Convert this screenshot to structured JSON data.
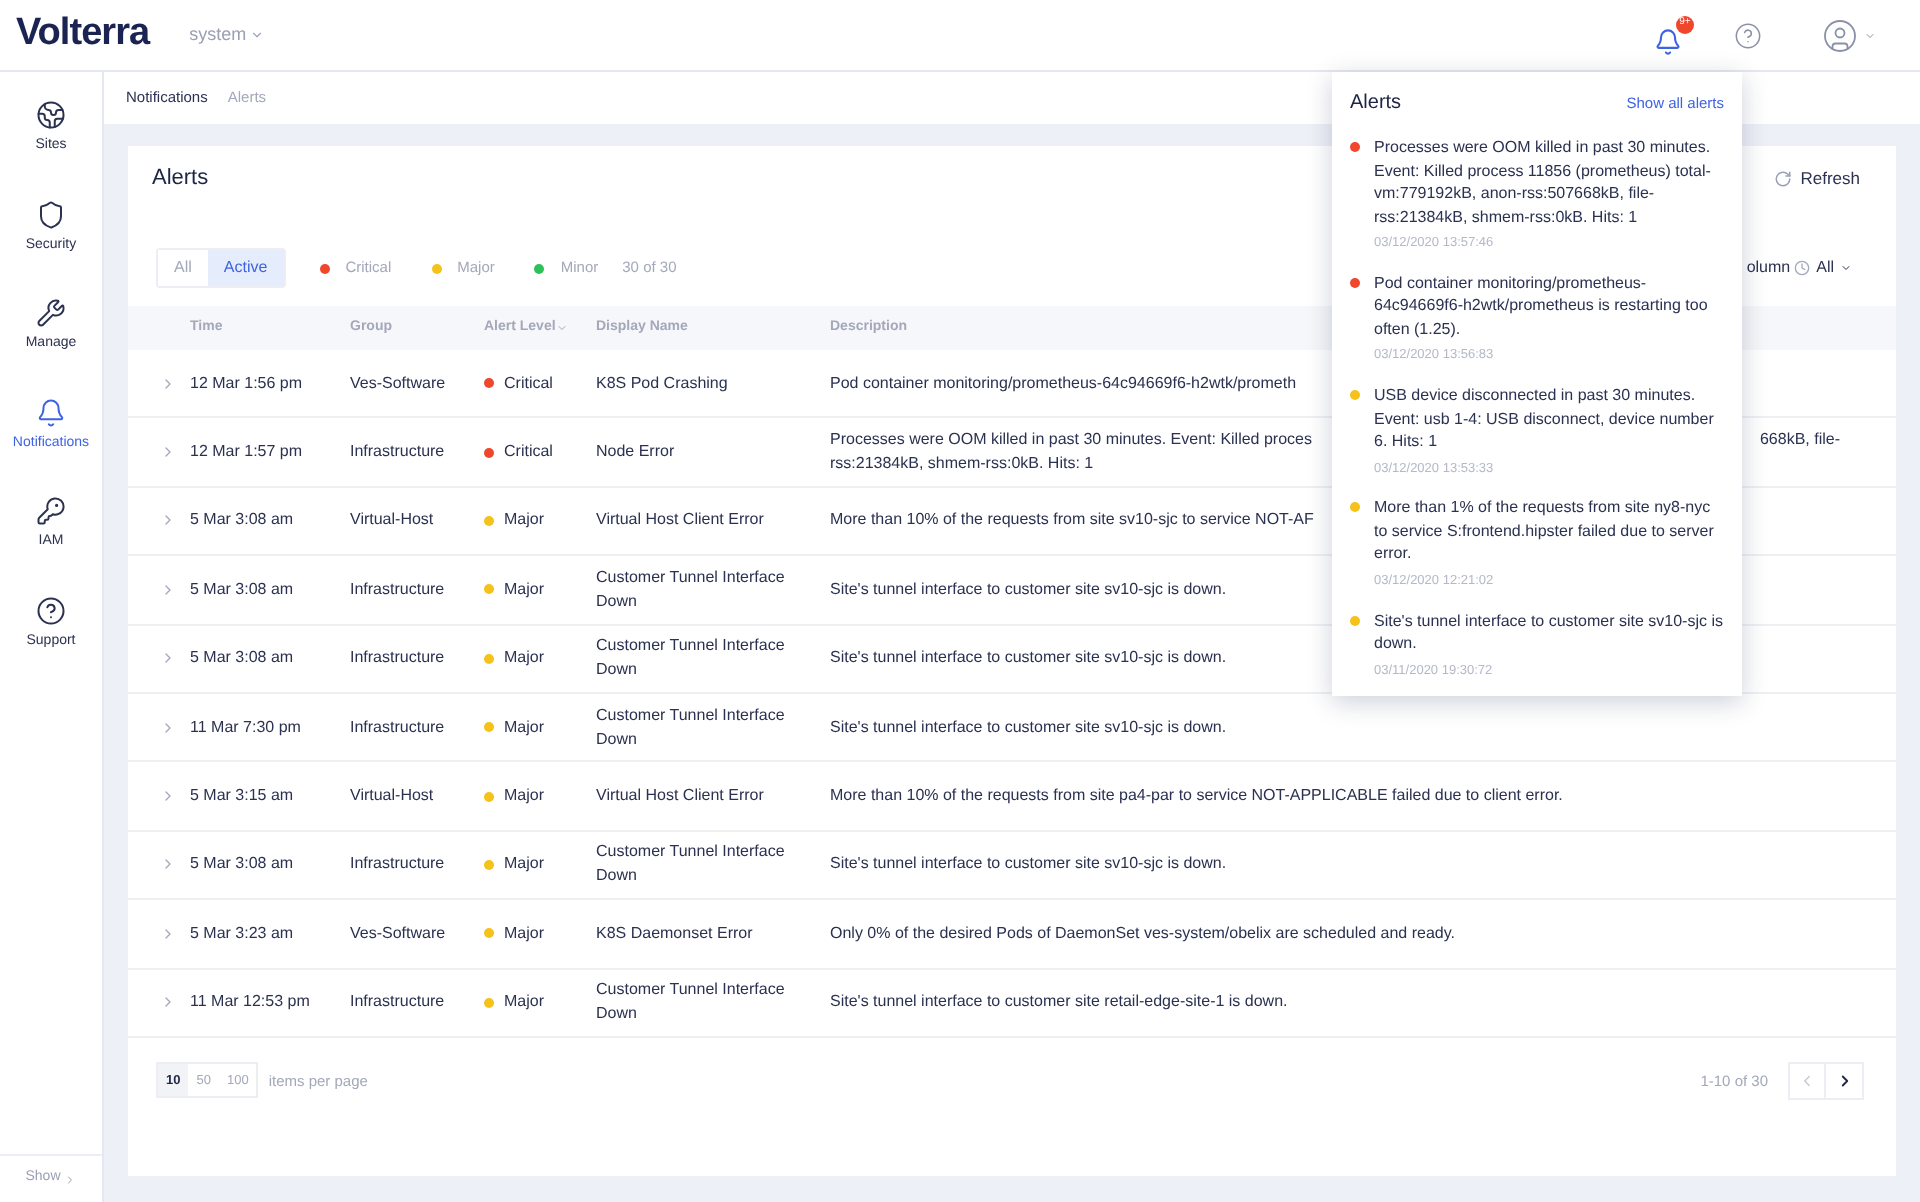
{
  "topbar": {
    "logo": "Volterra",
    "namespace": "system",
    "badge": "9+"
  },
  "sidebar": {
    "items": [
      {
        "label": "Sites",
        "kind": "sites",
        "selected": false
      },
      {
        "label": "Security",
        "kind": "security",
        "selected": false
      },
      {
        "label": "Manage",
        "kind": "manage",
        "selected": false
      },
      {
        "label": "Notifications",
        "kind": "notifications",
        "selected": true
      },
      {
        "label": "IAM",
        "kind": "iam",
        "selected": false
      },
      {
        "label": "Support",
        "kind": "support",
        "selected": false
      }
    ],
    "footer": "Show"
  },
  "breadcrumb": [
    "Notifications",
    "Alerts"
  ],
  "card": {
    "title": "Alerts",
    "refresh": "Refresh",
    "column_button": "olumn",
    "time_filter": "All"
  },
  "filter_tabs": [
    {
      "label": "All",
      "selected": false
    },
    {
      "label": "Active",
      "selected": true
    }
  ],
  "legend": [
    {
      "label": "Critical",
      "color": "#f0462c"
    },
    {
      "label": "Major",
      "color": "#f5c21b"
    },
    {
      "label": "Minor",
      "color": "#2ec15b"
    }
  ],
  "count": "30 of 30",
  "table": {
    "columns": [
      "Time",
      "Group",
      "Alert Level",
      "Display Name",
      "Description"
    ],
    "rows": [
      {
        "time": "12 Mar 1:56 pm",
        "group": "Ves-Software",
        "level": "Critical",
        "color": "#f0462c",
        "display_name": "K8S Pod Crashing",
        "description": "Pod container monitoring/prometheus-64c94669f6-h2wtk/prometh"
      },
      {
        "time": "12 Mar 1:57 pm",
        "group": "Infrastructure",
        "level": "Critical",
        "color": "#f0462c",
        "display_name": "Node Error",
        "description": "Processes were OOM killed in past 30 minutes. Event: Killed proces",
        "description_end": "668kB, file-",
        "description_line_2": "rss:21384kB, shmem-rss:0kB. Hits: 1"
      },
      {
        "time": "5 Mar 3:08 am",
        "group": "Virtual-Host",
        "level": "Major",
        "color": "#f5c21b",
        "display_name": "Virtual Host Client Error",
        "description": "More than 10% of the requests from site sv10-sjc to service NOT-AF"
      },
      {
        "time": "5 Mar 3:08 am",
        "group": "Infrastructure",
        "level": "Major",
        "color": "#f5c21b",
        "display_name": "Customer Tunnel Interface Down",
        "description": "Site's tunnel interface to customer site sv10-sjc is down."
      },
      {
        "time": "5 Mar 3:08 am",
        "group": "Infrastructure",
        "level": "Major",
        "color": "#f5c21b",
        "display_name": "Customer Tunnel Interface Down",
        "description": "Site's tunnel interface to customer site sv10-sjc is down."
      },
      {
        "time": "11 Mar 7:30 pm",
        "group": "Infrastructure",
        "level": "Major",
        "color": "#f5c21b",
        "display_name": "Customer Tunnel Interface Down",
        "description": "Site's tunnel interface to customer site sv10-sjc is down."
      },
      {
        "time": "5 Mar 3:15 am",
        "group": "Virtual-Host",
        "level": "Major",
        "color": "#f5c21b",
        "display_name": "Virtual Host Client Error",
        "description": "More than 10% of the requests from site pa4-par to service NOT-APPLICABLE failed due to client error."
      },
      {
        "time": "5 Mar 3:08 am",
        "group": "Infrastructure",
        "level": "Major",
        "color": "#f5c21b",
        "display_name": "Customer Tunnel Interface Down",
        "description": "Site's tunnel interface to customer site sv10-sjc is down."
      },
      {
        "time": "5 Mar 3:23 am",
        "group": "Ves-Software",
        "level": "Major",
        "color": "#f5c21b",
        "display_name": "K8S Daemonset Error",
        "description": "Only 0% of the desired Pods of DaemonSet ves-system/obelix are scheduled and ready."
      },
      {
        "time": "11 Mar 12:53 pm",
        "group": "Infrastructure",
        "level": "Major",
        "color": "#f5c21b",
        "display_name": "Customer Tunnel Interface Down",
        "description": "Site's tunnel interface to customer site retail-edge-site-1 is down."
      }
    ]
  },
  "pagination": {
    "page_sizes": [
      {
        "label": "10",
        "selected": true
      },
      {
        "label": "50",
        "selected": false
      },
      {
        "label": "100",
        "selected": false
      }
    ],
    "per_page_label": "items per page",
    "range": "1-10 of 30",
    "prev_disabled": true
  },
  "popup": {
    "title": "Alerts",
    "link": "Show all alerts",
    "items": [
      {
        "text": "Processes were OOM killed in past 30 minutes. Event: Killed process 11856 (prometheus) total-vm:779192kB, anon-rss:507668kB, file-rss:21384kB, shmem-rss:0kB. Hits: 1",
        "time": "03/12/2020 13:57:46",
        "color": "#f0462c"
      },
      {
        "text": "Pod container monitoring/prometheus-64c94669f6-h2wtk/prometheus is restarting too often (1.25).",
        "time": "03/12/2020 13:56:83",
        "color": "#f0462c"
      },
      {
        "text": "USB device disconnected in past 30 minutes. Event: usb 1-4: USB disconnect, device number 6. Hits: 1",
        "time": "03/12/2020 13:53:33",
        "color": "#f5c21b"
      },
      {
        "text": "More than 1% of the requests from site ny8-nyc to service S:frontend.hipster failed due to server error.",
        "time": "03/12/2020 12:21:02",
        "color": "#f5c21b"
      },
      {
        "text": "Site's tunnel interface to customer site sv10-sjc is down.",
        "time": "03/11/2020 19:30:72",
        "color": "#f5c21b"
      }
    ]
  }
}
